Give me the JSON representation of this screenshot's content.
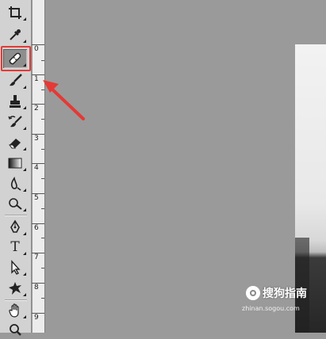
{
  "tools": [
    {
      "id": "crop-icon",
      "has_flyout": true
    },
    {
      "id": "eyedropper-icon",
      "has_flyout": true
    },
    {
      "id": "spot-healing-brush-icon",
      "has_flyout": true,
      "selected": true
    },
    {
      "id": "brush-icon",
      "has_flyout": true
    },
    {
      "id": "clone-stamp-icon",
      "has_flyout": true
    },
    {
      "id": "history-brush-icon",
      "has_flyout": true
    },
    {
      "id": "eraser-icon",
      "has_flyout": true
    },
    {
      "id": "gradient-icon",
      "has_flyout": true
    },
    {
      "id": "blur-icon",
      "has_flyout": true
    },
    {
      "id": "dodge-icon",
      "has_flyout": true
    },
    {
      "id": "pen-icon",
      "has_flyout": true
    },
    {
      "id": "type-tool-icon",
      "label": "T",
      "has_flyout": true
    },
    {
      "id": "path-selection-icon",
      "has_flyout": true
    },
    {
      "id": "custom-shape-icon",
      "has_flyout": true
    },
    {
      "id": "hand-icon",
      "has_flyout": true
    },
    {
      "id": "zoom-icon",
      "has_flyout": false
    }
  ],
  "ruler": {
    "numbers": [
      "0",
      "1",
      "2",
      "3",
      "4",
      "5",
      "6",
      "7",
      "8",
      "9"
    ]
  },
  "colors": {
    "canvas_background": "#9a9a9a",
    "highlight": "#e53935"
  },
  "watermark": {
    "main": "搜狗指南",
    "sub": "zhinan.sogou.com"
  }
}
